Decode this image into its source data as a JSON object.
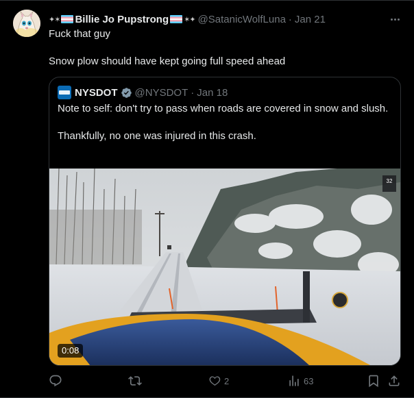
{
  "tweet": {
    "author": {
      "name": "Billie Jo Pupstrong",
      "handle": "@SatanicWolfLuna",
      "separator": "·",
      "date": "Jan 21",
      "name_decoration_left": "✦✶",
      "name_decoration_right": "✶✦"
    },
    "text_lines": [
      "Fuck that guy",
      "Snow plow should have kept going full speed ahead"
    ],
    "more_icon": "more-horizontal-icon"
  },
  "quoted": {
    "author": {
      "name": "NYSDOT",
      "handle": "@NYSDOT",
      "separator": "·",
      "date": "Jan 18",
      "verified": true
    },
    "text_paragraphs": [
      "Note to self: don't try to pass when roads are covered in snow and slush.",
      "Thankfully, no one was injured in this crash."
    ],
    "video": {
      "duration": "0:08",
      "overlay_speed": "32"
    }
  },
  "actions": {
    "reply": {
      "icon": "reply-icon",
      "count": ""
    },
    "repost": {
      "icon": "repost-icon",
      "count": ""
    },
    "like": {
      "icon": "heart-icon",
      "count": "2"
    },
    "views": {
      "icon": "analytics-icon",
      "count": "63"
    },
    "bookmark": {
      "icon": "bookmark-icon"
    },
    "share": {
      "icon": "share-icon"
    }
  },
  "colors": {
    "background": "#000000",
    "text": "#e7e9ea",
    "muted": "#71767b",
    "border": "#2f3336",
    "verified": "#829aab",
    "trans_flag": [
      "#5bcefa",
      "#f5a9b8",
      "#ffffff"
    ]
  }
}
